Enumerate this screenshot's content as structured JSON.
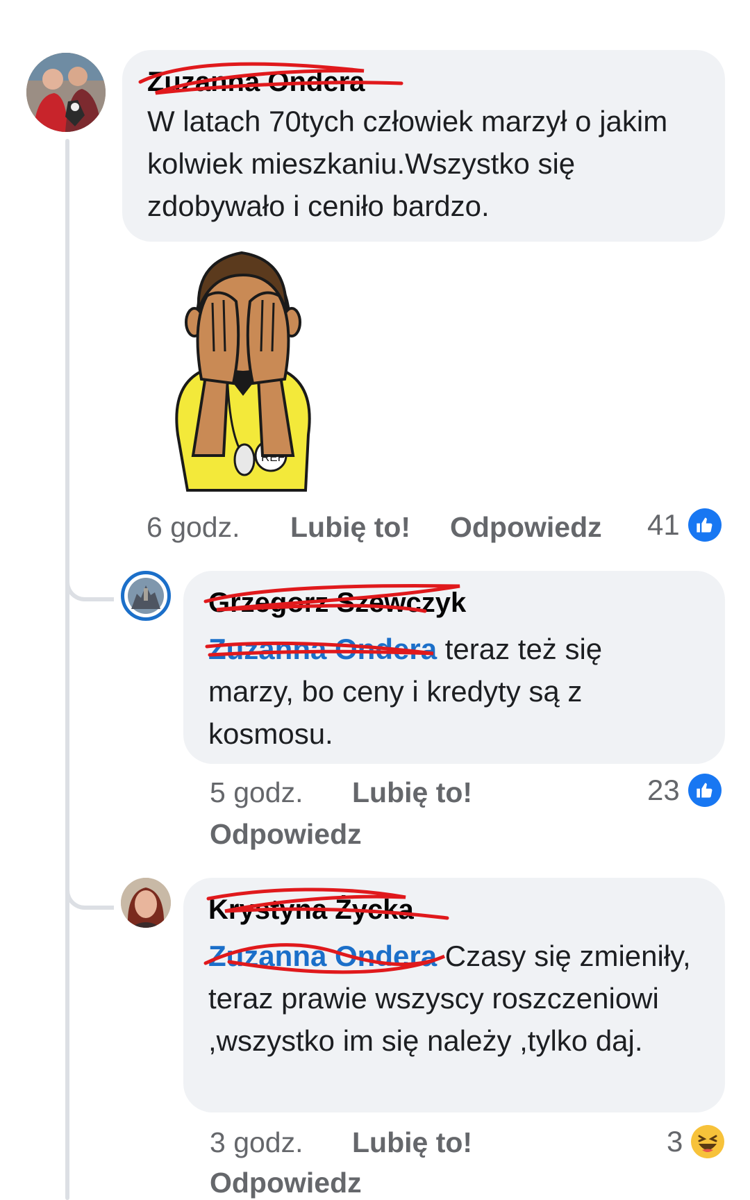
{
  "comment": {
    "author": "Zuzanna Ondera",
    "text": "W latach 70tych człowiek marzył o jakim kolwiek mieszkaniu.Wszystko się zdobywało i ceniło bardzo.",
    "sticker": "referee-covering-eyes-sticker",
    "sticker_badge": "REF",
    "time": "6 godz.",
    "like_label": "Lubię to!",
    "reply_label": "Odpowiedz",
    "reaction_count": "41",
    "reaction_type": "like-icon"
  },
  "replies": [
    {
      "author": "Grzegorz Szewczyk",
      "mention": "Zuzanna Ondera",
      "text": " teraz też się marzy, bo ceny i kredyty są z kosmosu.",
      "time": "5 godz.",
      "like_label": "Lubię to!",
      "reply_label": "Odpowiedz",
      "reaction_count": "23",
      "reaction_type": "like-icon"
    },
    {
      "author": "Krystyna Życka",
      "mention": "Zuzanna Ondera",
      "text": " Czasy się zmieniły, teraz prawie wszyscy roszczeniowi ,wszystko im się należy ,tylko daj.",
      "time": "3 godz.",
      "like_label": "Lubię to!",
      "reply_label": "Odpowiedz",
      "reaction_count": "3",
      "reaction_type": "haha-icon"
    }
  ],
  "colors": {
    "bubble": "#f0f2f5",
    "mention": "#1b6fc9",
    "like": "#1877f2",
    "scribble": "#e0191c"
  }
}
